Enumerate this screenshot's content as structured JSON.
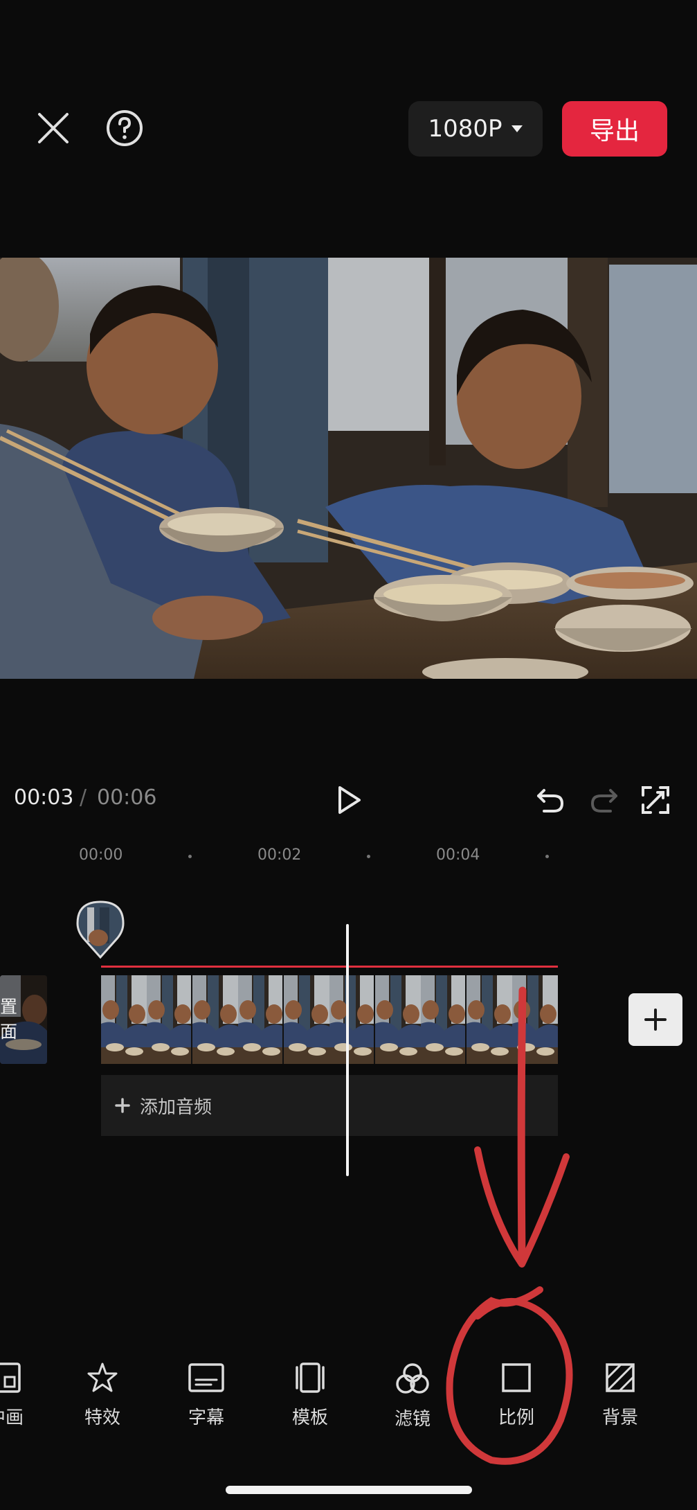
{
  "topbar": {
    "close_icon": "close-icon",
    "help_icon": "help-icon",
    "resolution_label": "1080P",
    "export_label": "导出"
  },
  "playback": {
    "current_time": "00:03",
    "separator": "/",
    "total_time": "00:06"
  },
  "ruler": {
    "ticks": [
      "00:00",
      "00:02",
      "00:04"
    ]
  },
  "timeline": {
    "cover_label_line1": "置",
    "cover_label_line2": "面",
    "add_audio_label": "添加音频"
  },
  "toolbar": {
    "items": [
      {
        "label": "中画",
        "icon": "picture-in-picture-icon"
      },
      {
        "label": "特效",
        "icon": "effects-star-icon"
      },
      {
        "label": "字幕",
        "icon": "subtitle-icon"
      },
      {
        "label": "模板",
        "icon": "template-icon"
      },
      {
        "label": "滤镜",
        "icon": "filter-icon"
      },
      {
        "label": "比例",
        "icon": "ratio-icon"
      },
      {
        "label": "背景",
        "icon": "background-icon"
      }
    ]
  },
  "annotation": {
    "color": "#d0383a",
    "arrow_icon": "arrow-down-annotation",
    "circle_icon": "circle-annotation"
  },
  "colors": {
    "accent": "#e4263f",
    "background": "#0b0b0b"
  }
}
